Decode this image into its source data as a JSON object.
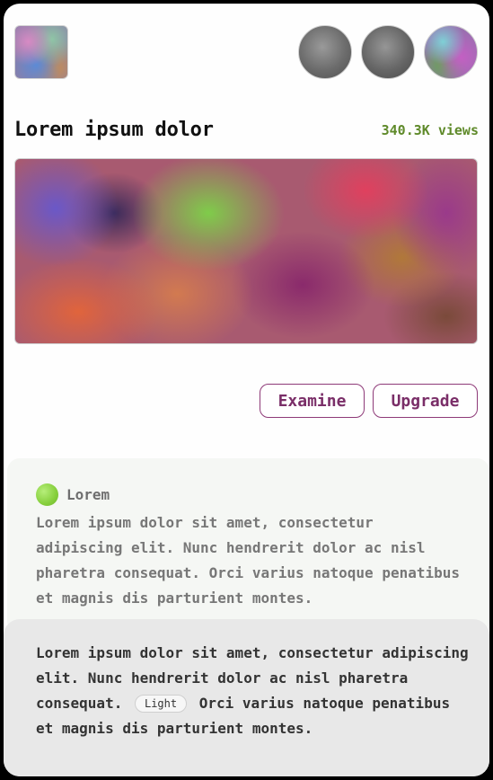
{
  "header": {
    "logo_icon": "app-logo-thumbnail",
    "avatars": [
      {
        "icon": "avatar-gray-1"
      },
      {
        "icon": "avatar-gray-2"
      },
      {
        "icon": "avatar-colorful"
      }
    ]
  },
  "video": {
    "title": "Lorem ipsum dolor",
    "views": "340.3K views",
    "thumbnail_icon": "video-thumbnail-blurred"
  },
  "actions": {
    "examine_label": "Examine",
    "upgrade_label": "Upgrade"
  },
  "comment": {
    "author": "Lorem",
    "body": "Lorem ipsum dolor sit amet, consectetur adipiscing elit. Nunc hendrerit dolor ac nisl pharetra consequat. Orci varius natoque penatibus et magnis dis parturient montes."
  },
  "reply": {
    "body_part1": "Lorem ipsum dolor sit amet, consectetur adipiscing elit. Nunc hendrerit dolor ac nisl pharetra consequat.",
    "tag": "Light",
    "body_part2": "Orci varius natoque penatibus et magnis dis parturient montes."
  },
  "colors": {
    "accent": "#7a2e68",
    "views": "#5f8a2a",
    "comment_bg": "#f5f7f4",
    "reply_bg": "#e8e8e8"
  }
}
